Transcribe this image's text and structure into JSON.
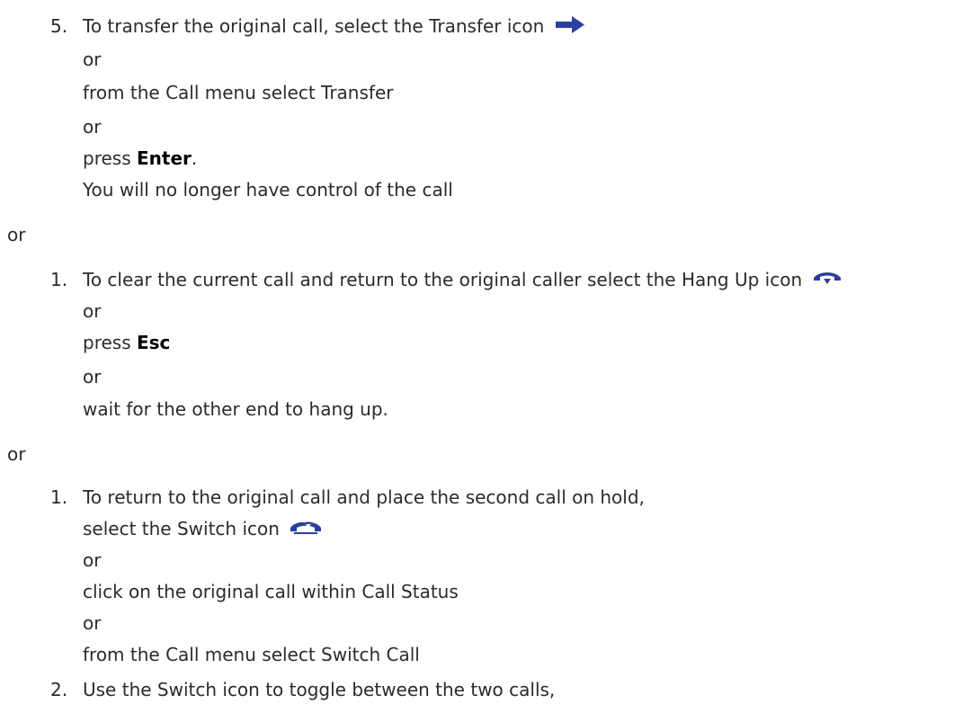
{
  "section_a": {
    "number": "5.",
    "lines": [
      "To transfer the original call, select the Transfer icon",
      "or",
      "from the Call menu select Transfer",
      "or",
      "press",
      "Enter",
      ".",
      "You will no longer have control of the call"
    ],
    "icon": "transfer-arrow-icon"
  },
  "separator_1": "or",
  "section_b": {
    "number": "1.",
    "lines": [
      "To clear the current call and return to the original caller select the Hang Up icon",
      "or",
      "press",
      "Esc",
      "or",
      "wait for the other end to hang up."
    ],
    "icon": "hang-up-icon"
  },
  "separator_2": "or",
  "section_c": {
    "number": "1.",
    "lines": [
      "To return to the original call and place the second call on hold,",
      "select the Switch icon",
      "or",
      "click on the original call within Call Status",
      "or",
      "from the Call menu select Switch Call"
    ],
    "icon": "switch-call-icon"
  },
  "section_d": {
    "number": "2.",
    "line": "Use the Switch icon to toggle between the two calls,"
  },
  "colors": {
    "text": "#2b2b2b",
    "icon_blue": "#2a3fa0"
  }
}
